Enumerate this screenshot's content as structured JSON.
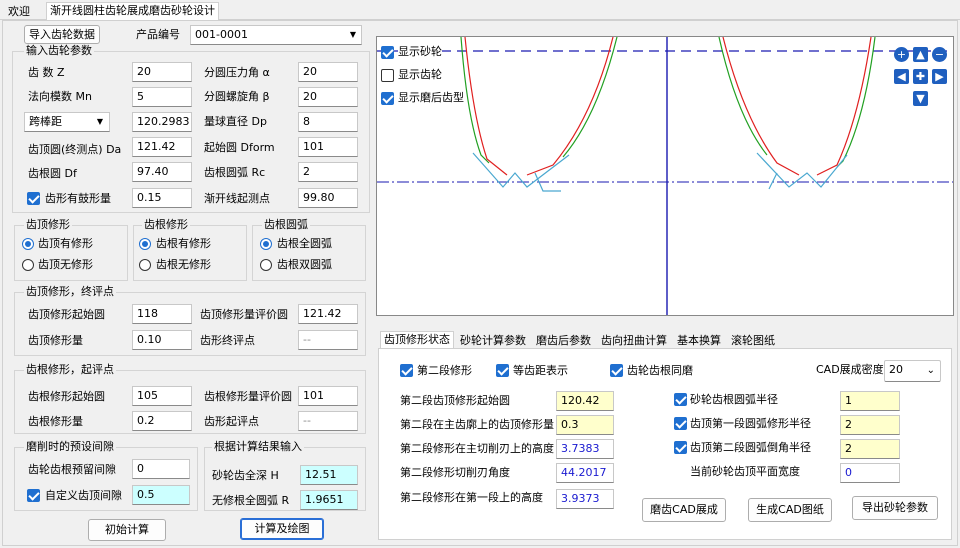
{
  "tabs": {
    "welcome": "欢迎",
    "main": "渐开线圆柱齿轮展成磨齿砂轮设计"
  },
  "top": {
    "import_btn": "导入齿轮数据",
    "product_label": "产品编号",
    "product_value": "001-0001"
  },
  "input_group": {
    "title": "输入齿轮参数",
    "teeth_label": "齿    数    Z",
    "teeth_value": "20",
    "pressure_label": "分圆压力角   α",
    "pressure_value": "20",
    "module_label": "法向模数  Mn",
    "module_value": "5",
    "helix_label": "分圆螺旋角   β",
    "helix_value": "20",
    "span_select": "跨棒距",
    "span_value": "120.2983",
    "ball_label": "量球直径  Dp",
    "ball_value": "8",
    "tip_label": "齿顶圆(终测点) Da",
    "tip_value": "121.42",
    "start_label": "起始圆     Dform",
    "start_value": "101",
    "root_label": "齿根圆     Df",
    "root_value": "97.40",
    "root_arc_label": "齿根圆弧   Rc",
    "root_arc_value": "2",
    "crown_label": "齿形有鼓形量",
    "crown_value": "0.15",
    "involute_label": "渐开线起测点",
    "involute_value": "99.80"
  },
  "tip_mod": {
    "title": "齿顶修形",
    "opt1": "齿顶有修形",
    "opt2": "齿顶无修形"
  },
  "root_mod": {
    "title": "齿根修形",
    "opt1": "齿根有修形",
    "opt2": "齿根无修形"
  },
  "root_arc": {
    "title": "齿根圆弧",
    "opt1": "齿根全圆弧",
    "opt2": "齿根双圆弧"
  },
  "tip_eval": {
    "title": "齿顶修形，终评点",
    "start_label": "齿顶修形起始圆",
    "start_value": "118",
    "eval_label": "齿顶修形量评价圆",
    "eval_value": "121.42",
    "amount_label": "齿顶修形量",
    "amount_value": "0.10",
    "end_label": "齿形终评点",
    "end_value": "--"
  },
  "root_eval": {
    "title": "齿根修形，起评点",
    "start_label": "齿根修形起始圆",
    "start_value": "105",
    "eval_label": "齿根修形量评价圆",
    "eval_value": "101",
    "amount_label": "齿根修形量",
    "amount_value": "0.2",
    "begin_label": "齿形起评点",
    "begin_value": "--"
  },
  "preset": {
    "title": "磨削时的预设间隙",
    "root_gap_label": "齿轮齿根预留间隙",
    "root_gap_value": "0",
    "custom_label": "自定义齿顶间隙",
    "custom_value": "0.5"
  },
  "calc_input": {
    "title": "根据计算结果输入",
    "depth_label": "砂轮齿全深  H",
    "depth_value": "12.51",
    "radius_label": "无修根全圆弧  R",
    "radius_value": "1.9651"
  },
  "bottom_buttons": {
    "init": "初始计算",
    "calc": "计算及绘图"
  },
  "plot": {
    "show_wheel": "显示砂轮",
    "show_gear": "显示齿轮",
    "show_ground": "显示磨后齿型",
    "colors": {
      "axis": "#1a1ab0",
      "green": "#22a022",
      "red": "#e02020",
      "cyan": "#4aa8d0",
      "dash": "#1a1ab0"
    }
  },
  "right_tabs": [
    "齿顶修形状态",
    "砂轮计算参数",
    "磨齿后参数",
    "齿向扭曲计算",
    "基本换算",
    "滚轮图纸"
  ],
  "right_panel": {
    "second_mod": "第二段修形",
    "equal_pitch": "等齿距表示",
    "same_grind": "齿轮齿根同磨",
    "density_label": "CAD展成密度",
    "density_value": "20",
    "row1_label": "第二段齿顶修形起始圆",
    "row1_value": "120.42",
    "row2_label": "第二段在主齿廓上的齿顶修形量",
    "row2_value": "0.3",
    "row3_label": "第二段修形在主切削刃上的高度",
    "row3_value": "3.7383",
    "row4_label": "第二段修形切削刃角度",
    "row4_value": "44.2017",
    "row5_label": "第二段修形在第一段上的高度",
    "row5_value": "3.9373",
    "r1_label": "砂轮齿根圆弧半径",
    "r1_value": "1",
    "r2_label": "齿顶第一段圆弧修形半径",
    "r2_value": "2",
    "r3_label": "齿顶第二段圆弧倒角半径",
    "r3_value": "2",
    "flat_label": "当前砂轮齿顶平面宽度",
    "flat_value": "0",
    "btn_cad": "磨齿CAD展成",
    "btn_drawing": "生成CAD图纸",
    "btn_export": "导出砂轮参数"
  }
}
